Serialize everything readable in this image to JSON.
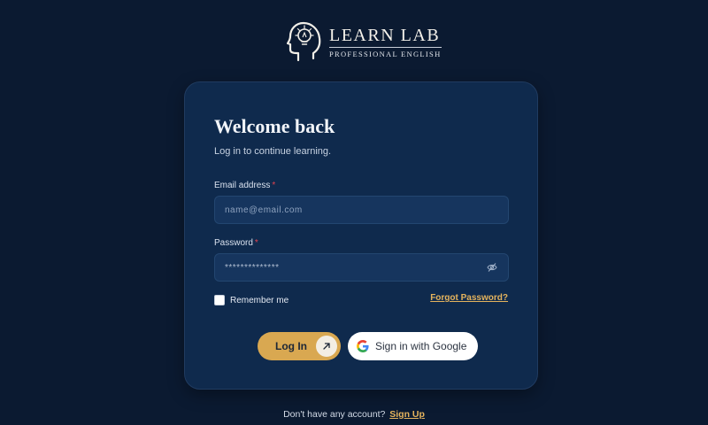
{
  "brand": {
    "title": "LEARN LAB",
    "subtitle": "PROFESSIONAL ENGLISH",
    "logo_icon": "head-lightbulb-icon"
  },
  "card": {
    "title": "Welcome back",
    "subtitle": "Log in to continue learning."
  },
  "form": {
    "email": {
      "label": "Email address",
      "required_mark": "*",
      "placeholder": "name@email.com",
      "value": ""
    },
    "password": {
      "label": "Password",
      "required_mark": "*",
      "value": "**************",
      "toggle_icon": "eye-off-icon"
    },
    "remember_label": "Remember me",
    "remember_checked": false,
    "forgot_label": "Forgot Password?"
  },
  "actions": {
    "login_label": "Log In",
    "login_icon": "arrow-up-right-icon",
    "google_label": "Sign in with Google",
    "google_icon": "google-icon"
  },
  "footer": {
    "prompt": "Don't have any account?",
    "signup_label": "Sign Up"
  },
  "colors": {
    "background": "#0b1a31",
    "card": "#0f2a4d",
    "accent": "#d9a851",
    "link": "#e4b35d",
    "required": "#e0424f"
  }
}
